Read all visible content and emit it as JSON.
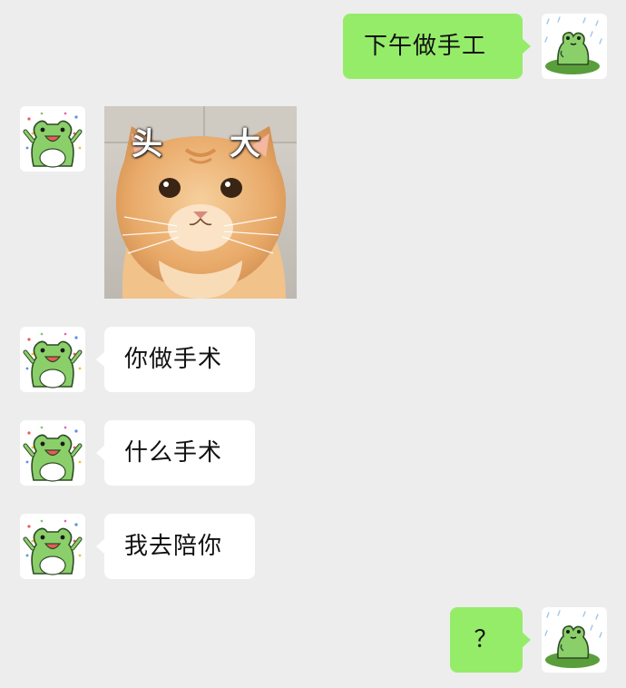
{
  "chat": {
    "messages": [
      {
        "from": "me",
        "type": "text",
        "text": "下午做手工",
        "avatar": "frog-on-lily-pad-icon"
      },
      {
        "from": "friend",
        "type": "sticker",
        "sticker": {
          "caption_left": "头",
          "caption_right": "大",
          "subject": "orange cat"
        },
        "avatar": "cheering-frog-icon"
      },
      {
        "from": "friend",
        "type": "text",
        "text": "你做手术",
        "avatar": "cheering-frog-icon"
      },
      {
        "from": "friend",
        "type": "text",
        "text": "什么手术",
        "avatar": "cheering-frog-icon"
      },
      {
        "from": "friend",
        "type": "text",
        "text": "我去陪你",
        "avatar": "cheering-frog-icon"
      },
      {
        "from": "me",
        "type": "text",
        "text": "？",
        "avatar": "frog-on-lily-pad-icon"
      }
    ]
  },
  "colors": {
    "background": "#ededed",
    "sent_bubble": "#95ec69",
    "received_bubble": "#ffffff",
    "frog_green": "#8bcf6a"
  }
}
